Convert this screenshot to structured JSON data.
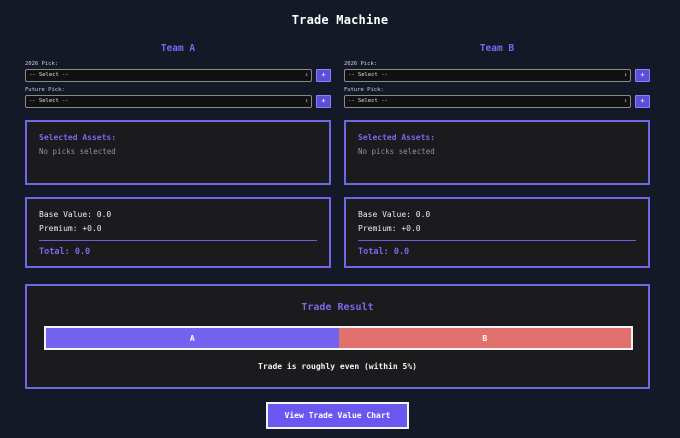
{
  "title": "Trade Machine",
  "teams": [
    {
      "heading": "Team A",
      "pick_2026_label": "2026 Pick:",
      "pick_2026_value": "-- Select --",
      "future_pick_label": "Future Pick:",
      "future_pick_value": "-- Select --",
      "add_label": "+",
      "assets_heading": "Selected Assets:",
      "assets_empty": "No picks selected",
      "base_value": "Base Value: 0.0",
      "premium": "Premium: +0.0",
      "total": "Total: 0.0"
    },
    {
      "heading": "Team B",
      "pick_2026_label": "2026 Pick:",
      "pick_2026_value": "-- Select --",
      "future_pick_label": "Future Pick:",
      "future_pick_value": "-- Select --",
      "add_label": "+",
      "assets_heading": "Selected Assets:",
      "assets_empty": "No picks selected",
      "base_value": "Base Value: 0.0",
      "premium": "Premium: +0.0",
      "total": "Total: 0.0"
    }
  ],
  "result": {
    "title": "Trade Result",
    "bar_a_label": "A",
    "bar_b_label": "B",
    "team_a_share_percent": 50,
    "message": "Trade is roughly even (within 5%)"
  },
  "chart_button_label": "View Trade Value Chart",
  "colors": {
    "accent": "#7b68ee",
    "team_a_bar": "#7363ef",
    "team_b_bar": "#e2706d",
    "background": "#131927",
    "panel": "#1b1b1d"
  },
  "icons": {
    "select_caret": "↕",
    "add": "plus-icon"
  }
}
